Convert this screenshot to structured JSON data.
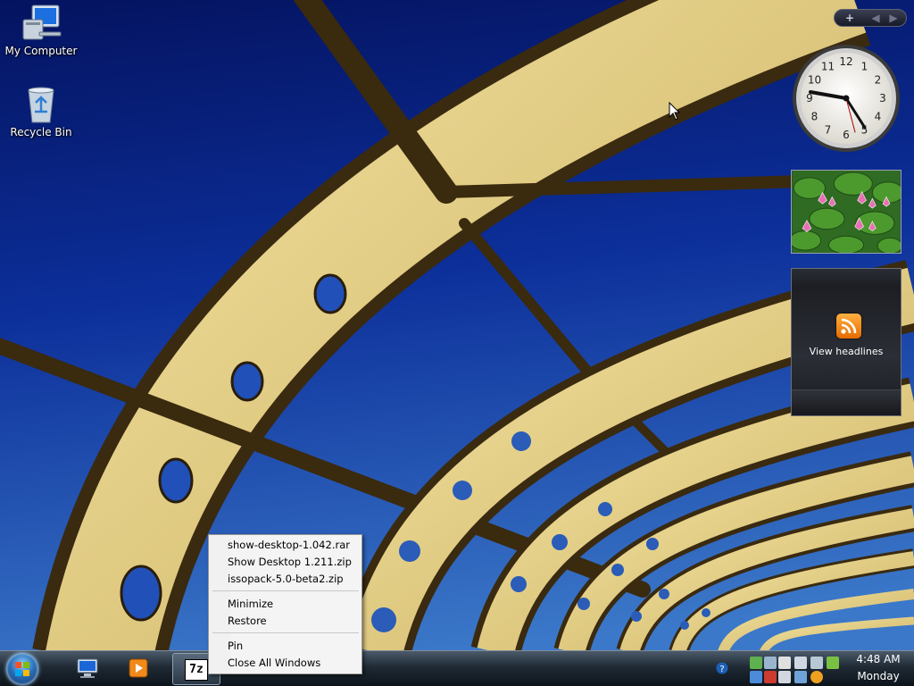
{
  "desktop": {
    "icons": [
      {
        "label": "My Computer",
        "icon": "computer-icon"
      },
      {
        "label": "Recycle Bin",
        "icon": "recycle-bin-icon"
      }
    ]
  },
  "sidebar": {
    "controls": {
      "add": "+",
      "prev": "◀",
      "next": "▶"
    },
    "clock": {
      "hour_numbers": [
        "12",
        "1",
        "2",
        "3",
        "4",
        "5",
        "6",
        "7",
        "8",
        "9",
        "10",
        "11"
      ],
      "time": "4:48"
    },
    "feed": {
      "label": "View headlines",
      "icon": "rss-icon"
    }
  },
  "jump_menu": {
    "recent": [
      "show-desktop-1.042.rar",
      "Show Desktop 1.211.zip",
      "issopack-5.0-beta2.zip"
    ],
    "window_actions": [
      "Minimize",
      "Restore"
    ],
    "other_actions": [
      "Pin",
      "Close All Windows"
    ]
  },
  "taskbar": {
    "start_icon": "windows-logo-icon",
    "quick_launch": [
      "show-desktop-icon",
      "media-player-icon"
    ],
    "active_program": {
      "label": "7z",
      "icon": "7zip-icon"
    },
    "clock": {
      "time": "4:48 AM",
      "day": "Monday"
    }
  },
  "colors": {
    "sky_top": "#041a6e",
    "sky_bottom": "#2f6ec4",
    "arch": "#e8d48a",
    "taskbar": "#1f2a35"
  }
}
